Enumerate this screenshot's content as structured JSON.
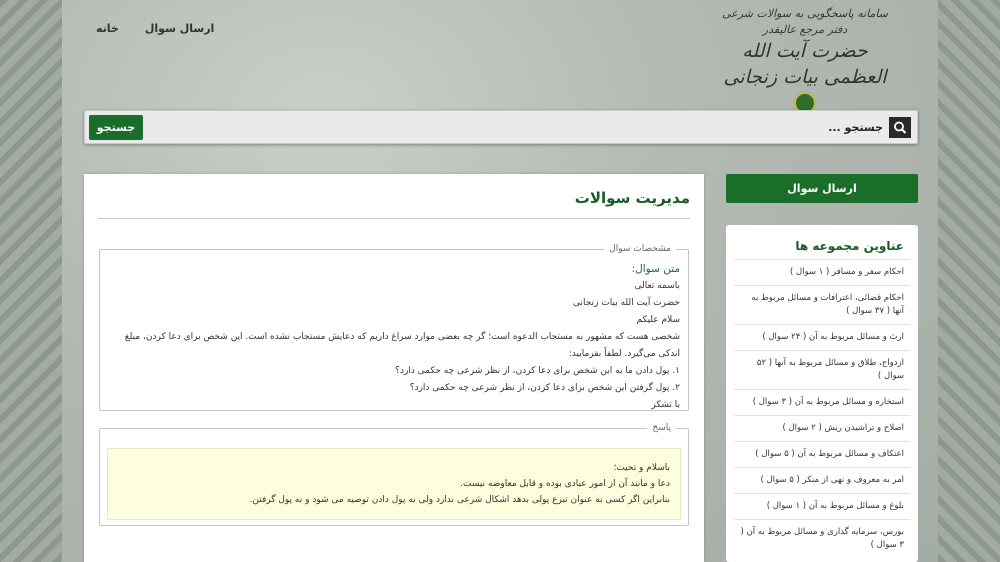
{
  "header": {
    "nav": [
      "خانه",
      "ارسال سوال"
    ],
    "logo": {
      "line1": "سامانه پاسخگویی به سوالات شرعی",
      "line2": "دفتر مرجع عالیقدر",
      "line3": "حضرت آیت الله العظمی بیات زنجانی"
    }
  },
  "search": {
    "placeholder": "جستجو ...",
    "button_label": "جستجو"
  },
  "main": {
    "title": "مدیریت سوالات",
    "question": {
      "legend": "مشخصات سوال",
      "label": "متن سوال:",
      "lines": [
        "باسمه تعالی",
        "حضرت آیت الله بیات زنجانی",
        "سلام علیکم",
        "شخصی هست که مشهور به مستجاب الدعوه است؛ گر چه بعضی موارد سراغ داریم که دعایش مستجاب نشده است. این شخص برای دعا کردن، مبلغ اندکی می‌گیرد. لطفاً بفرمایید:",
        "۱. پول دادن ما به این شخص برای دعا کردن، از نظر شرعی چه حکمی دارد؟",
        "۲. پول گرفتن این شخص برای دعا کردن، از نظر شرعی چه حکمی دارد؟",
        "با تشکر"
      ]
    },
    "answer": {
      "legend": "پاسخ",
      "lines": [
        "باسلام و تحیت؛",
        "دعا و مانند آن از امور عبادی بوده و قابل معاوضه نیست.",
        "بنابراین اگر کسی به عنوان تبرع پولی بدهد اشکال شرعی ندارد ولی نه پول دادن توصیه می شود و نه پول گرفتن."
      ]
    }
  },
  "sidebar": {
    "ask_button": "ارسال سوال",
    "categories_title": "عناوین مجموعه ها",
    "categories": [
      "احکام سفر و مسافر ( ۱ سوال )",
      "احکام قضائی، اعترافات و مسائل مربوط به آنها ( ۳۷ سوال )",
      "ارث و مسائل مربوط به آن ( ۲۴ سوال )",
      "ازدواج، طلاق و مسائل مربوط به آنها ( ۵۲ سوال )",
      "استخاره و مسائل مربوط به آن ( ۳ سوال )",
      "اصلاح و تراشیدن ریش ( ۲ سوال )",
      "اعتکاف و مسائل مربوط به آن ( ۵ سوال )",
      "امر به معروف و نهی از منکر ( ۵ سوال )",
      "بلوغ و مسائل مربوط به آن ( ۱ سوال )",
      "بورس، سرمایه گذاری و مسائل مربوط به آن ( ۳ سوال )"
    ]
  },
  "colors": {
    "brand_green": "#1a6e2a",
    "title_green": "#1a5a28",
    "answer_bg": "#fcfedd"
  }
}
